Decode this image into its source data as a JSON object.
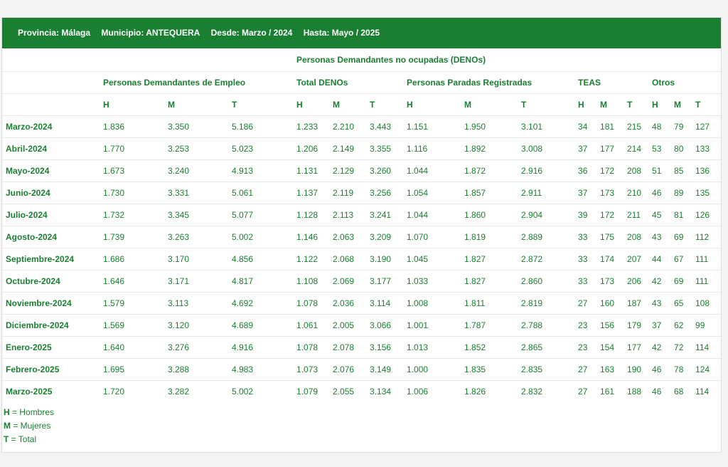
{
  "banner": {
    "provincia": "Provincia: Málaga",
    "municipio": "Municipio: ANTEQUERA",
    "desde": "Desde: Marzo / 2024",
    "hasta": "Hasta: Mayo / 2025"
  },
  "headers": {
    "deno_group": "Personas Demandantes no ocupadas (DENOs)",
    "demandantes": "Personas Demandantes de Empleo",
    "total_denos": "Total DENOs",
    "paradas": "Personas Paradas Registradas",
    "teas": "TEAS",
    "otros": "Otros",
    "h": "H",
    "m": "M",
    "t": "T"
  },
  "rows": [
    {
      "month": "Marzo-2024",
      "v": [
        "1.836",
        "3.350",
        "5.186",
        "1.233",
        "2.210",
        "3.443",
        "1.151",
        "1.950",
        "3.101",
        "34",
        "181",
        "215",
        "48",
        "79",
        "127"
      ]
    },
    {
      "month": "Abril-2024",
      "v": [
        "1.770",
        "3.253",
        "5.023",
        "1.206",
        "2.149",
        "3.355",
        "1.116",
        "1.892",
        "3.008",
        "37",
        "177",
        "214",
        "53",
        "80",
        "133"
      ]
    },
    {
      "month": "Mayo-2024",
      "v": [
        "1.673",
        "3.240",
        "4.913",
        "1.131",
        "2.129",
        "3.260",
        "1.044",
        "1.872",
        "2.916",
        "36",
        "172",
        "208",
        "51",
        "85",
        "136"
      ]
    },
    {
      "month": "Junio-2024",
      "v": [
        "1.730",
        "3.331",
        "5.061",
        "1.137",
        "2.119",
        "3.256",
        "1.054",
        "1.857",
        "2.911",
        "37",
        "173",
        "210",
        "46",
        "89",
        "135"
      ]
    },
    {
      "month": "Julio-2024",
      "v": [
        "1.732",
        "3.345",
        "5.077",
        "1.128",
        "2.113",
        "3.241",
        "1.044",
        "1.860",
        "2.904",
        "39",
        "172",
        "211",
        "45",
        "81",
        "126"
      ]
    },
    {
      "month": "Agosto-2024",
      "v": [
        "1.739",
        "3.263",
        "5.002",
        "1.146",
        "2.063",
        "3.209",
        "1.070",
        "1.819",
        "2.889",
        "33",
        "175",
        "208",
        "43",
        "69",
        "112"
      ]
    },
    {
      "month": "Septiembre-2024",
      "v": [
        "1.686",
        "3.170",
        "4.856",
        "1.122",
        "2.068",
        "3.190",
        "1.045",
        "1.827",
        "2.872",
        "33",
        "174",
        "207",
        "44",
        "67",
        "111"
      ]
    },
    {
      "month": "Octubre-2024",
      "v": [
        "1.646",
        "3.171",
        "4.817",
        "1.108",
        "2.069",
        "3.177",
        "1.033",
        "1.827",
        "2.860",
        "33",
        "173",
        "206",
        "42",
        "69",
        "111"
      ]
    },
    {
      "month": "Noviembre-2024",
      "v": [
        "1.579",
        "3.113",
        "4.692",
        "1.078",
        "2.036",
        "3.114",
        "1.008",
        "1.811",
        "2.819",
        "27",
        "160",
        "187",
        "43",
        "65",
        "108"
      ]
    },
    {
      "month": "Diciembre-2024",
      "v": [
        "1.569",
        "3.120",
        "4.689",
        "1.061",
        "2.005",
        "3.066",
        "1.001",
        "1.787",
        "2.788",
        "23",
        "156",
        "179",
        "37",
        "62",
        "99"
      ]
    },
    {
      "month": "Enero-2025",
      "v": [
        "1.640",
        "3.276",
        "4.916",
        "1.078",
        "2.078",
        "3.156",
        "1.013",
        "1.852",
        "2.865",
        "23",
        "154",
        "177",
        "42",
        "72",
        "114"
      ]
    },
    {
      "month": "Febrero-2025",
      "v": [
        "1.695",
        "3.288",
        "4.983",
        "1.073",
        "2.076",
        "3.149",
        "1.000",
        "1.835",
        "2.835",
        "27",
        "163",
        "190",
        "46",
        "78",
        "124"
      ]
    },
    {
      "month": "Marzo-2025",
      "v": [
        "1.720",
        "3.282",
        "5.002",
        "1.079",
        "2.055",
        "3.134",
        "1.006",
        "1.826",
        "2.832",
        "27",
        "161",
        "188",
        "46",
        "68",
        "114"
      ]
    }
  ],
  "legend": [
    {
      "key": "H",
      "text": " = Hombres"
    },
    {
      "key": "M",
      "text": " = Mujeres"
    },
    {
      "key": "T",
      "text": " = Total"
    }
  ]
}
